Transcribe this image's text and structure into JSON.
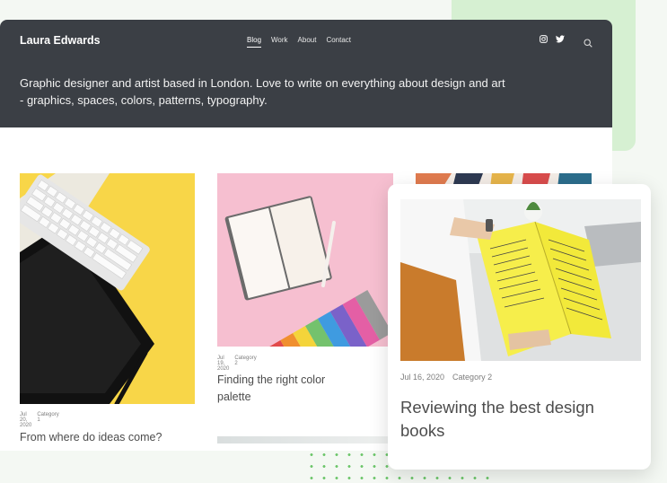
{
  "header": {
    "brand": "Laura Edwards",
    "nav": [
      {
        "label": "Blog",
        "active": true
      },
      {
        "label": "Work",
        "active": false
      },
      {
        "label": "About",
        "active": false
      },
      {
        "label": "Contact",
        "active": false
      }
    ],
    "icons": [
      "instagram-icon",
      "twitter-icon",
      "search-icon"
    ],
    "tagline": "Graphic designer and artist based in London. Love to write on everything about design and art - graphics, spaces, colors, patterns, typography."
  },
  "posts": [
    {
      "date": "Jul 20, 2020",
      "category": "Category 1",
      "title": "From where do ideas come?"
    },
    {
      "date": "Jul 19, 2020",
      "category": "Category 2",
      "title": "Finding the right color palette"
    },
    {
      "date": "Jul 16, 2020",
      "category": "Category 2",
      "title": "Reviewing the best design books"
    }
  ],
  "colors": {
    "header_bg": "#3b3f45",
    "accent_green": "#d6f0d2",
    "yellow": "#f8d648",
    "pink": "#f6bfd0"
  }
}
